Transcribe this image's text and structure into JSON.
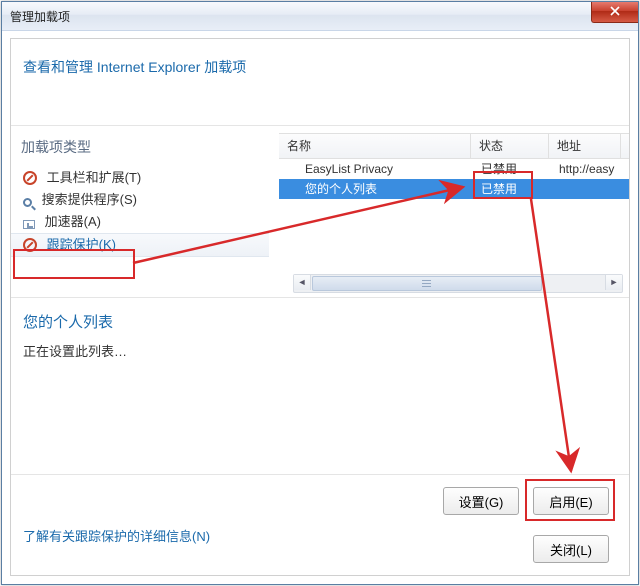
{
  "window": {
    "title": "管理加载项"
  },
  "intro": "查看和管理 Internet Explorer 加载项",
  "sidebar": {
    "title": "加载项类型",
    "items": [
      {
        "label": "工具栏和扩展(T)"
      },
      {
        "label": "搜索提供程序(S)"
      },
      {
        "label": "加速器(A)"
      },
      {
        "label": "跟踪保护(K)"
      }
    ]
  },
  "list": {
    "headers": {
      "name": "名称",
      "status": "状态",
      "address": "地址"
    },
    "rows": [
      {
        "name": "EasyList Privacy",
        "status": "已禁用",
        "address": "http://easy"
      },
      {
        "name": "您的个人列表",
        "status": "已禁用",
        "address": ""
      }
    ]
  },
  "detail": {
    "title": "您的个人列表",
    "sub": "正在设置此列表…"
  },
  "buttons": {
    "settings": "设置(G)",
    "enable": "启用(E)",
    "close": "关闭(L)"
  },
  "link_more": "了解有关跟踪保护的详细信息(N)"
}
